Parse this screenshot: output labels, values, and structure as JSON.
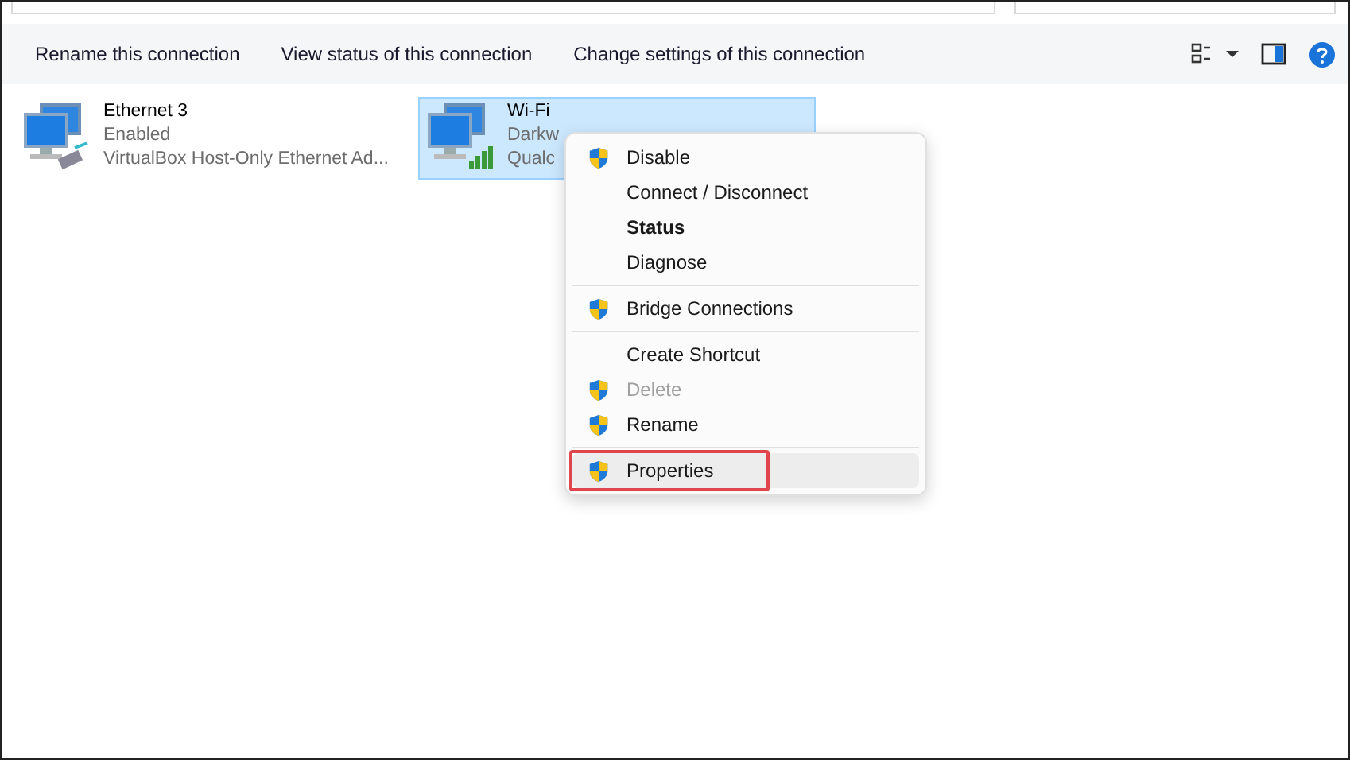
{
  "toolbar": {
    "commands": [
      "Rename this connection",
      "View status of this connection",
      "Change settings of this connection"
    ]
  },
  "connections": [
    {
      "kind": "wired",
      "name": "Ethernet 3",
      "status": "Enabled",
      "device": "VirtualBox Host-Only Ethernet Ad...",
      "selected": false
    },
    {
      "kind": "wifi",
      "name": "Wi-Fi",
      "status": "Darkw",
      "device": "Qualc",
      "selected": true
    }
  ],
  "context_menu": {
    "items": [
      {
        "kind": "item",
        "label": "Disable",
        "shield": true,
        "bold": false,
        "disabled": false,
        "selected": false
      },
      {
        "kind": "item",
        "label": "Connect / Disconnect",
        "shield": false,
        "bold": false,
        "disabled": false,
        "selected": false
      },
      {
        "kind": "item",
        "label": "Status",
        "shield": false,
        "bold": true,
        "disabled": false,
        "selected": false
      },
      {
        "kind": "item",
        "label": "Diagnose",
        "shield": false,
        "bold": false,
        "disabled": false,
        "selected": false
      },
      {
        "kind": "separator"
      },
      {
        "kind": "item",
        "label": "Bridge Connections",
        "shield": true,
        "bold": false,
        "disabled": false,
        "selected": false
      },
      {
        "kind": "separator"
      },
      {
        "kind": "item",
        "label": "Create Shortcut",
        "shield": false,
        "bold": false,
        "disabled": false,
        "selected": false
      },
      {
        "kind": "item",
        "label": "Delete",
        "shield": true,
        "bold": false,
        "disabled": true,
        "selected": false
      },
      {
        "kind": "item",
        "label": "Rename",
        "shield": true,
        "bold": false,
        "disabled": false,
        "selected": false
      },
      {
        "kind": "separator"
      },
      {
        "kind": "item",
        "label": "Properties",
        "shield": true,
        "bold": false,
        "disabled": false,
        "selected": true
      }
    ]
  }
}
